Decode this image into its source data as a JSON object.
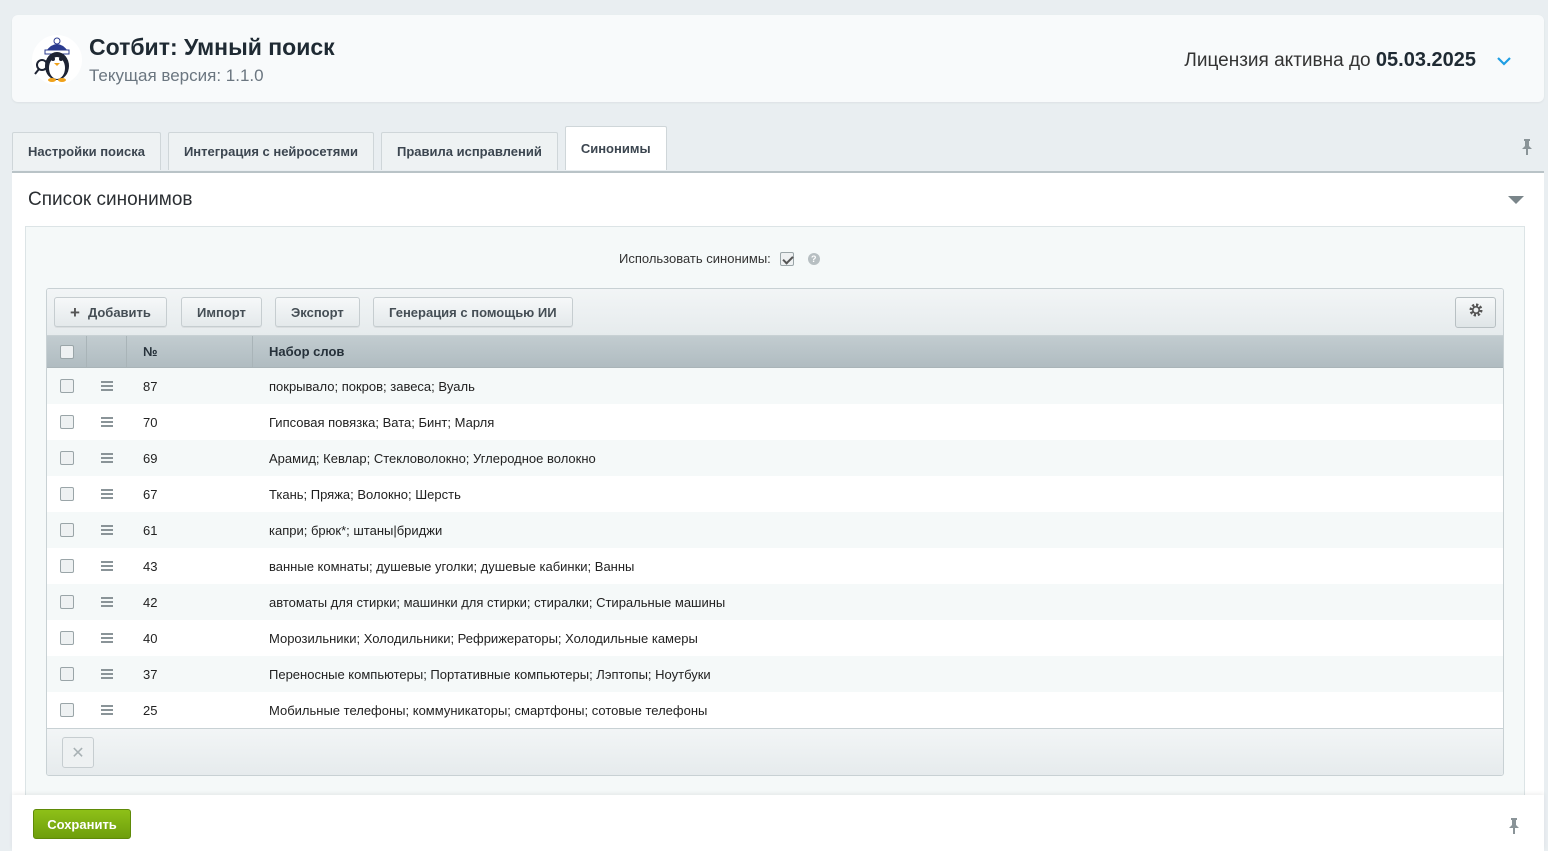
{
  "header": {
    "title": "Сотбит: Умный поиск",
    "version": "Текущая версия: 1.1.0",
    "license_prefix": "Лицензия активна до ",
    "license_date": "05.03.2025"
  },
  "tabs": [
    {
      "label": "Настройки поиска",
      "active": false
    },
    {
      "label": "Интеграция с нейросетями",
      "active": false
    },
    {
      "label": "Правила исправлений",
      "active": false
    },
    {
      "label": "Синонимы",
      "active": true
    }
  ],
  "section": {
    "title": "Список синонимов",
    "use_label": "Использовать синонимы:",
    "use_checked": true
  },
  "toolbar": {
    "add": "Добавить",
    "import": "Импорт",
    "export": "Экспорт",
    "generate": "Генерация с помощью ИИ"
  },
  "table": {
    "col_num": "№",
    "col_words": "Набор слов",
    "rows": [
      {
        "num": "87",
        "words": "покрывало; покров; завеса; Вуаль"
      },
      {
        "num": "70",
        "words": "Гипсовая повязка; Вата; Бинт; Марля"
      },
      {
        "num": "69",
        "words": "Арамид; Кевлар; Стекловолокно; Углеродное волокно"
      },
      {
        "num": "67",
        "words": "Ткань; Пряжа; Волокно; Шерсть"
      },
      {
        "num": "61",
        "words": "капри; брюк*; штаны|бриджи"
      },
      {
        "num": "43",
        "words": "ванные комнаты; душевые уголки; душевые кабинки; Ванны"
      },
      {
        "num": "42",
        "words": "автоматы для стирки; машинки для стирки; стиралки; Стиральные машины"
      },
      {
        "num": "40",
        "words": "Морозильники; Холодильники; Рефрижераторы; Холодильные камеры"
      },
      {
        "num": "37",
        "words": "Переносные компьютеры; Портативные компьютеры; Лэптопы; Ноутбуки"
      },
      {
        "num": "25",
        "words": "Мобильные телефоны; коммуникаторы; смартфоны; сотовые телефоны"
      }
    ]
  },
  "footer": {
    "delete_symbol": "✕",
    "save": "Сохранить"
  },
  "colors": {
    "accent": "#1f9ee3",
    "save_green": "#7aad12"
  }
}
